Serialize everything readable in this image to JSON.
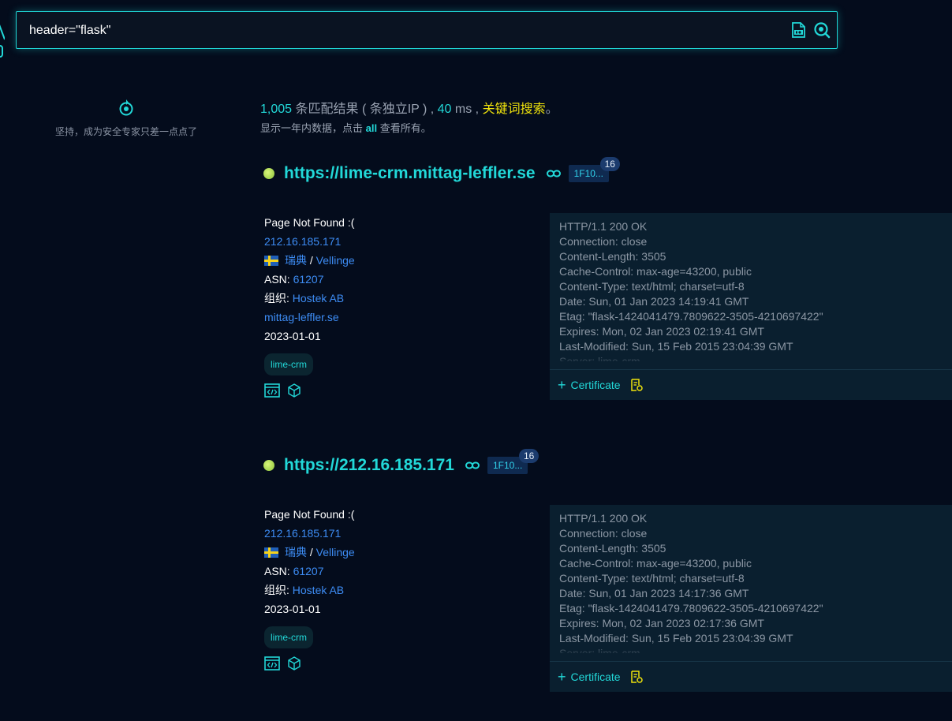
{
  "search": {
    "query": "header=\"flask\""
  },
  "sidebar": {
    "tip": "坚持，成为安全专家只差一点点了"
  },
  "summary": {
    "count": "1,005",
    "count_label": " 条匹配结果 ( 条独立IP ) , ",
    "time": "40",
    "time_label": " ms , ",
    "keyword_search": "关键词搜索",
    "period": "。",
    "line2_before": "显示一年内数据，点击 ",
    "line2_all": "all",
    "line2_after": " 查看所有。"
  },
  "results": [
    {
      "url": "https://lime-crm.mittag-leffler.se",
      "hash": "1F10...",
      "hash_count": "16",
      "title": "Page Not Found :(",
      "ip": "212.16.185.171",
      "country": "瑞典",
      "sep": " / ",
      "city": "Vellinge",
      "asn_label": "ASN: ",
      "asn": "61207",
      "org_label": "组织: ",
      "org": "Hostek AB",
      "domain": "mittag-leffler.se",
      "date": "2023-01-01",
      "tag": "lime-crm",
      "headers": "HTTP/1.1 200 OK\nConnection: close\nContent-Length: 3505\nCache-Control: max-age=43200, public\nContent-Type: text/html; charset=utf-8\nDate: Sun, 01 Jan 2023 14:19:41 GMT\nEtag: \"flask-1424041479.7809622-3505-4210697422\"\nExpires: Mon, 02 Jan 2023 02:19:41 GMT\nLast-Modified: Sun, 15 Feb 2015 23:04:39 GMT\nServer: lime-crm",
      "certificate": "Certificate"
    },
    {
      "url": "https://212.16.185.171",
      "hash": "1F10...",
      "hash_count": "16",
      "title": "Page Not Found :(",
      "ip": "212.16.185.171",
      "country": "瑞典",
      "sep": " / ",
      "city": "Vellinge",
      "asn_label": "ASN: ",
      "asn": "61207",
      "org_label": "组织: ",
      "org": "Hostek AB",
      "date": "2023-01-01",
      "tag": "lime-crm",
      "headers": "HTTP/1.1 200 OK\nConnection: close\nContent-Length: 3505\nCache-Control: max-age=43200, public\nContent-Type: text/html; charset=utf-8\nDate: Sun, 01 Jan 2023 14:17:36 GMT\nEtag: \"flask-1424041479.7809622-3505-4210697422\"\nExpires: Mon, 02 Jan 2023 02:17:36 GMT\nLast-Modified: Sun, 15 Feb 2015 23:04:39 GMT\nServer: lime-crm",
      "certificate": "Certificate"
    }
  ],
  "colors": {
    "accent": "#22d8d8",
    "link": "#3d8cf4",
    "keyword": "#f0e30c",
    "background": "#040c1c"
  },
  "icons": [
    "ico-search-icon",
    "zoom-search-icon",
    "target-icon",
    "link-icon",
    "sweden-flag-icon",
    "code-icon",
    "cube-icon",
    "certificate-icon"
  ]
}
